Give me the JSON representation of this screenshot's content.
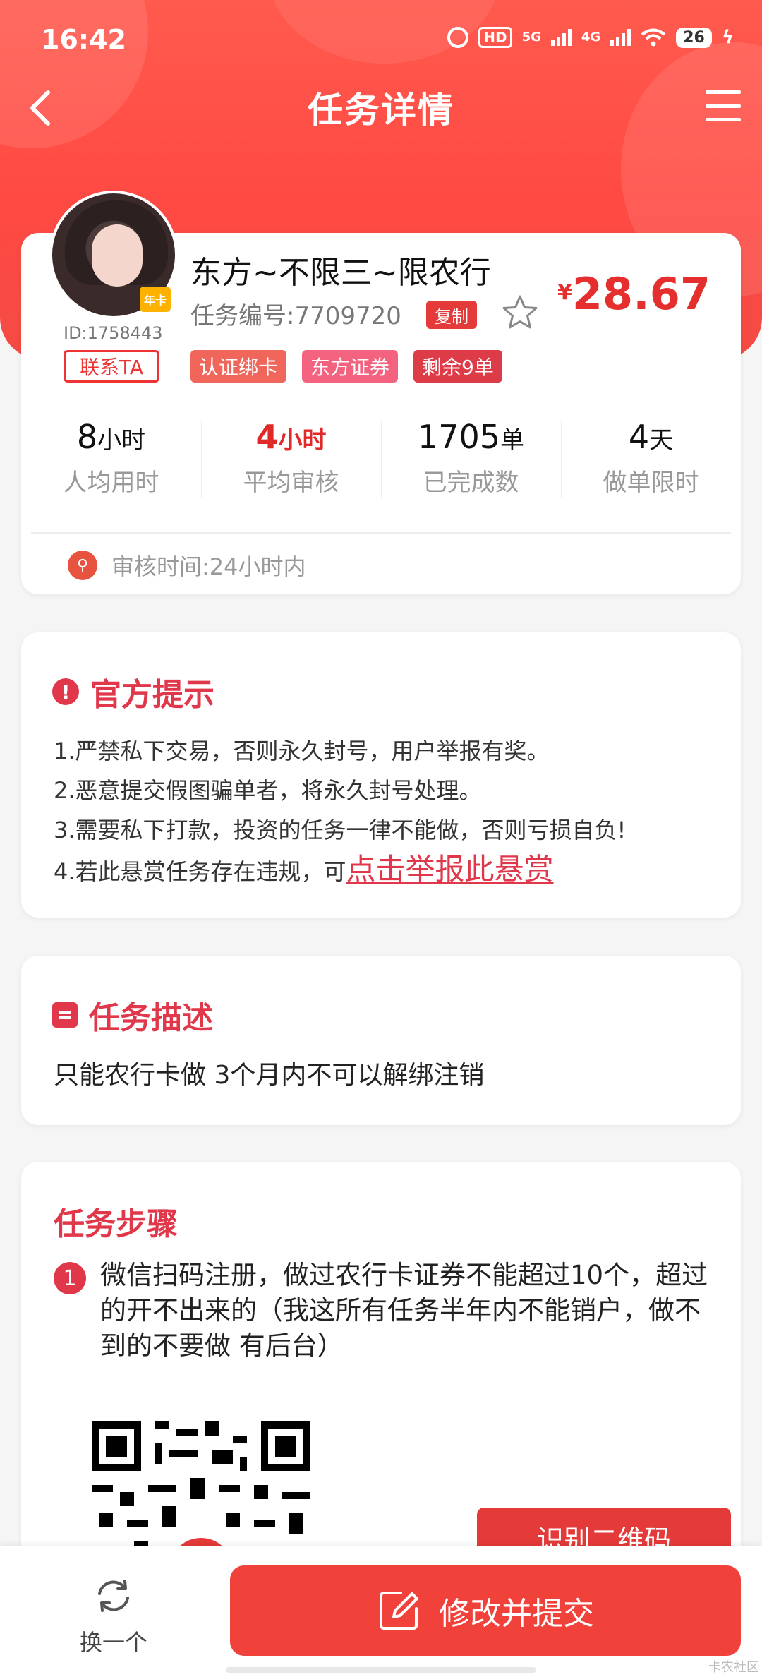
{
  "status_bar": {
    "time": "16:42",
    "hd": "HD",
    "net1": "5G",
    "net2": "4G",
    "battery": "26"
  },
  "header": {
    "title": "任务详情"
  },
  "task": {
    "name": "东方~不限三~限农行",
    "task_no": "任务编号:7709720",
    "copy_label": "复制",
    "currency": "¥",
    "price": "28.67",
    "user_id": "ID:1758443",
    "contact_label": "联系TA",
    "badge": "年卡",
    "tags": [
      "认证绑卡",
      "东方证券",
      "剩余9单"
    ],
    "stats": [
      {
        "num": "8",
        "unit": "小时",
        "label": "人均用时"
      },
      {
        "num": "4",
        "unit": "小时",
        "label": "平均审核"
      },
      {
        "num": "1705",
        "unit": "单",
        "label": "已完成数"
      },
      {
        "num": "4",
        "unit": "天",
        "label": "做单限时"
      }
    ],
    "audit_text": "审核时间:24小时内"
  },
  "tips": {
    "title": "官方提示",
    "items": [
      "1.严禁私下交易，否则永久封号，用户举报有奖。",
      "2.恶意提交假图骗单者，将永久封号处理。",
      "3.需要私下打款，投资的任务一律不能做，否则亏损自负!",
      "4.若此悬赏任务存在违规，可"
    ],
    "report_link": "点击举报此悬赏"
  },
  "description": {
    "title": "任务描述",
    "text": "只能农行卡做  3个月内不可以解绑注销"
  },
  "steps": {
    "title": "任务步骤",
    "step1_num": "1",
    "step1_text": "微信扫码注册，做过农行卡证券不能超过10个，超过的开不出来的（我这所有任务半年内不能销户，做不到的不要做 有后台）",
    "qr_button": "识别二维码"
  },
  "bottom": {
    "swap_label": "换一个",
    "submit_label": "修改并提交"
  },
  "watermark": "卡农社区",
  "colors": {
    "primary": "#f0423a",
    "accent": "#e0384a",
    "price": "#e52e2e"
  }
}
